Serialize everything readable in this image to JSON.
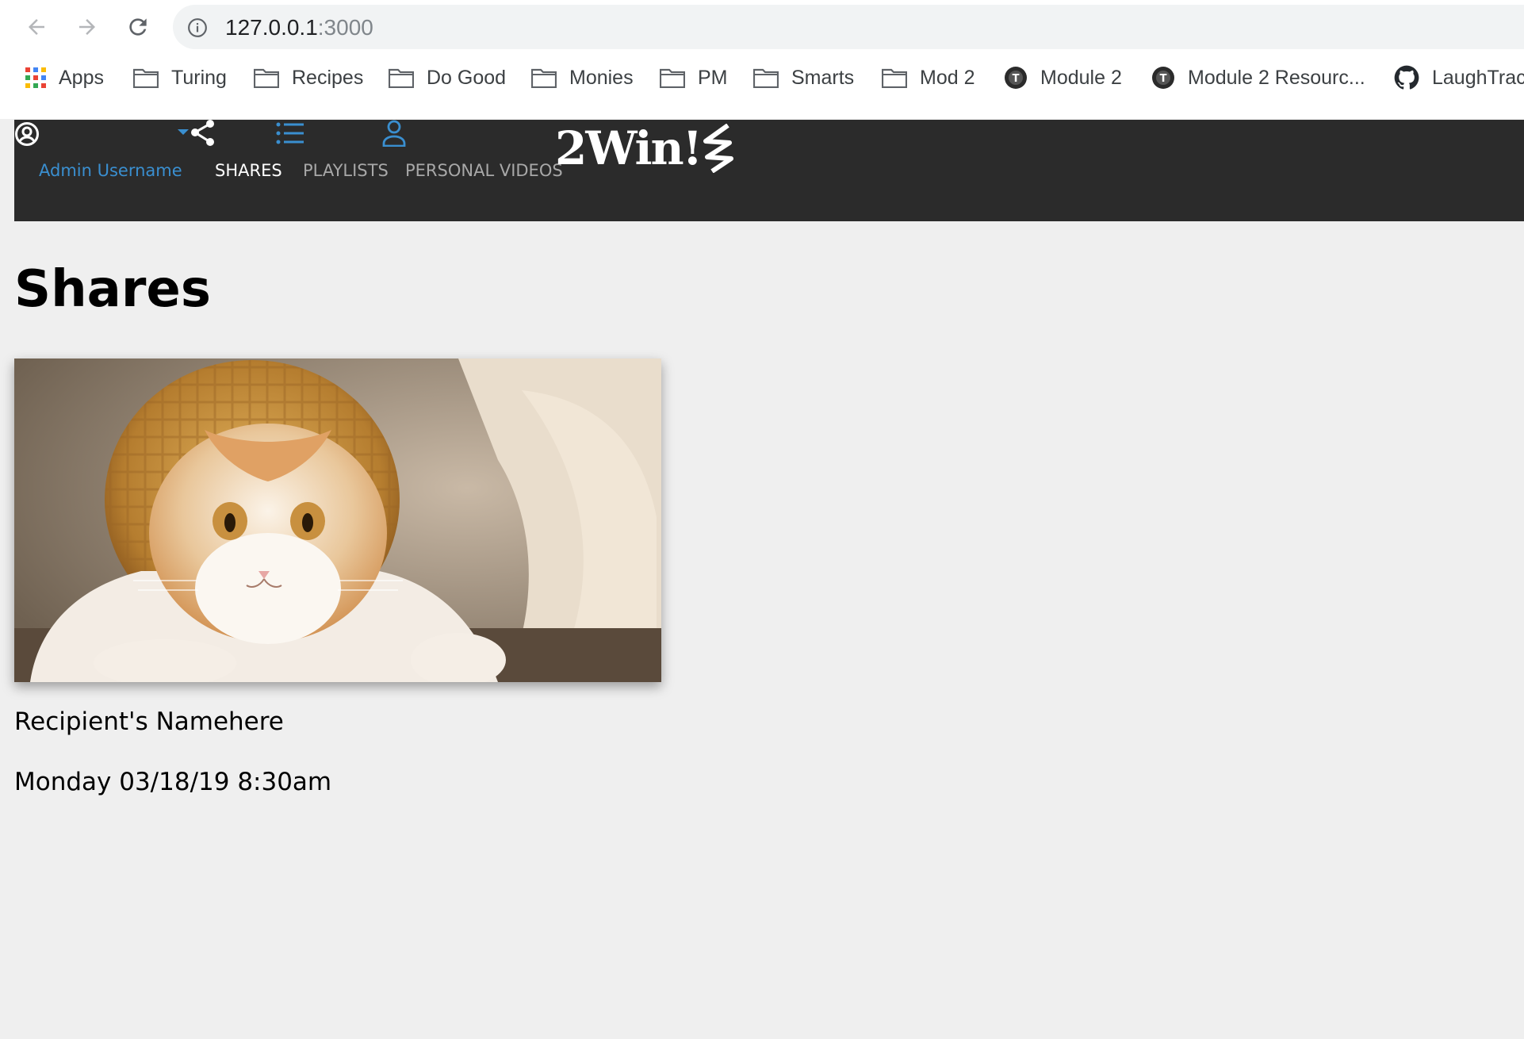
{
  "browser": {
    "url_host": "127.0.0.1",
    "url_port": ":3000",
    "bookmarks": [
      {
        "label": "Apps",
        "icon": "apps-grid-icon"
      },
      {
        "label": "Turing",
        "icon": "folder-icon"
      },
      {
        "label": "Recipes",
        "icon": "folder-icon"
      },
      {
        "label": "Do Good",
        "icon": "folder-icon"
      },
      {
        "label": "Monies",
        "icon": "folder-icon"
      },
      {
        "label": "PM",
        "icon": "folder-icon"
      },
      {
        "label": "Smarts",
        "icon": "folder-icon"
      },
      {
        "label": "Mod 2",
        "icon": "folder-icon"
      },
      {
        "label": "Module 2",
        "icon": "turing-logo-icon"
      },
      {
        "label": "Module 2 Resourc...",
        "icon": "turing-logo-icon"
      },
      {
        "label": "LaughTrac",
        "icon": "github-icon"
      }
    ]
  },
  "nav": {
    "user_label": "Admin Username",
    "items": [
      {
        "label": "SHARES",
        "icon": "share-icon",
        "active": true
      },
      {
        "label": "PLAYLISTS",
        "icon": "list-icon",
        "active": false
      },
      {
        "label": "PERSONAL VIDEOS",
        "icon": "person-icon",
        "active": false
      }
    ],
    "logo_text": "2Win!"
  },
  "page": {
    "title": "Shares"
  },
  "share": {
    "recipient": "Recipient's Namehere",
    "timestamp": "Monday 03/18/19 8:30am"
  },
  "colors": {
    "nav_bg": "#2b2b2b",
    "accent_blue": "#3a8fd0",
    "page_bg": "#efefef"
  }
}
